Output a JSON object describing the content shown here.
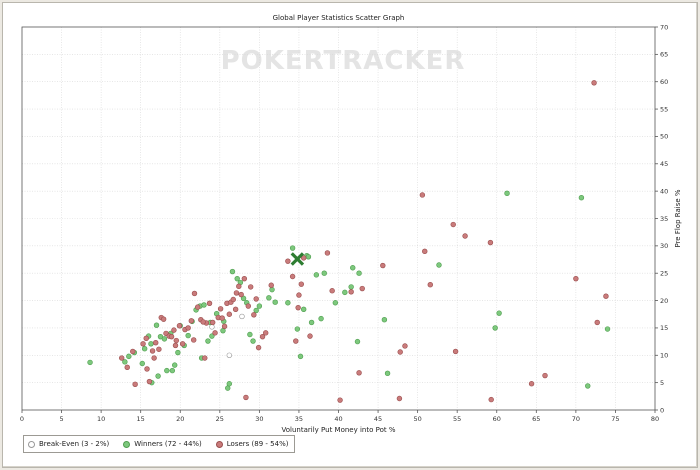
{
  "chart_data": {
    "type": "scatter",
    "title": "Global Player Statistics Scatter Graph",
    "watermark": "POKERTRACKER",
    "xlabel": "Voluntarily Put Money into Pot %",
    "ylabel": "Pre Flop Raise %",
    "xlim": [
      0,
      80
    ],
    "ylim": [
      0,
      70
    ],
    "xticks": [
      0,
      5,
      10,
      15,
      20,
      25,
      30,
      35,
      40,
      45,
      50,
      55,
      60,
      65,
      70,
      75,
      80
    ],
    "yticks": [
      0,
      5,
      10,
      15,
      20,
      25,
      30,
      35,
      40,
      45,
      50,
      55,
      60,
      65,
      70
    ],
    "y_axis_side": "right",
    "grid": true,
    "legend_position": "bottom-left",
    "hero_point": {
      "x": 34.8,
      "y": 27.6,
      "color": "#2e7d32"
    },
    "series": [
      {
        "name": "Break-Even (3 - 2%)",
        "color": "#ffffff",
        "stroke": "#999999",
        "points": [
          [
            26.2,
            10
          ],
          [
            24.0,
            15.2
          ],
          [
            27.8,
            17.1
          ]
        ]
      },
      {
        "name": "Winners (72 - 44%)",
        "color": "#7dc87d",
        "stroke": "#4f9e4f",
        "points": [
          [
            8.6,
            8.7
          ],
          [
            13.0,
            8.8
          ],
          [
            13.5,
            9.8
          ],
          [
            14.2,
            10.5
          ],
          [
            15.2,
            8.5
          ],
          [
            15.5,
            11.2
          ],
          [
            16.0,
            13.5
          ],
          [
            16.3,
            12.1
          ],
          [
            16.4,
            5.0
          ],
          [
            17.0,
            15.5
          ],
          [
            17.2,
            6.2
          ],
          [
            17.5,
            13.4
          ],
          [
            18.0,
            13.0
          ],
          [
            18.3,
            7.2
          ],
          [
            18.8,
            14.0
          ],
          [
            19.0,
            7.2
          ],
          [
            19.3,
            8.2
          ],
          [
            19.7,
            10.5
          ],
          [
            20.0,
            15.4
          ],
          [
            20.5,
            11.8
          ],
          [
            21.0,
            13.6
          ],
          [
            21.5,
            16.2
          ],
          [
            22.0,
            18.3
          ],
          [
            22.5,
            19.0
          ],
          [
            22.7,
            9.5
          ],
          [
            23.0,
            19.2
          ],
          [
            23.5,
            12.6
          ],
          [
            23.8,
            16.0
          ],
          [
            24.0,
            13.5
          ],
          [
            24.6,
            17.6
          ],
          [
            25.4,
            14.5
          ],
          [
            25.5,
            16.2
          ],
          [
            26.0,
            4.0
          ],
          [
            26.2,
            4.8
          ],
          [
            26.6,
            25.3
          ],
          [
            27.2,
            24.0
          ],
          [
            27.6,
            23.3
          ],
          [
            28.0,
            20.4
          ],
          [
            28.4,
            19.6
          ],
          [
            28.8,
            13.8
          ],
          [
            29.2,
            12.6
          ],
          [
            29.6,
            18.2
          ],
          [
            30.0,
            19.0
          ],
          [
            31.2,
            20.5
          ],
          [
            31.6,
            22.0
          ],
          [
            32.0,
            19.7
          ],
          [
            33.6,
            19.6
          ],
          [
            34.2,
            29.6
          ],
          [
            34.8,
            14.8
          ],
          [
            35.2,
            9.8
          ],
          [
            35.6,
            18.4
          ],
          [
            36.0,
            28.2
          ],
          [
            36.6,
            16.0
          ],
          [
            37.2,
            24.7
          ],
          [
            37.8,
            16.7
          ],
          [
            38.2,
            25.0
          ],
          [
            39.6,
            19.6
          ],
          [
            40.8,
            21.5
          ],
          [
            41.6,
            22.5
          ],
          [
            41.8,
            26.0
          ],
          [
            42.4,
            12.5
          ],
          [
            42.6,
            25.0
          ],
          [
            45.8,
            16.5
          ],
          [
            46.2,
            6.7
          ],
          [
            52.7,
            26.5
          ],
          [
            59.8,
            15.0
          ],
          [
            60.3,
            17.7
          ],
          [
            61.3,
            39.6
          ],
          [
            70.7,
            38.8
          ],
          [
            71.5,
            4.4
          ],
          [
            74.0,
            14.8
          ],
          [
            36.2,
            28.0
          ]
        ]
      },
      {
        "name": "Losers (89 - 54%)",
        "color": "#c97b7b",
        "stroke": "#9a4e4e",
        "points": [
          [
            12.6,
            9.5
          ],
          [
            13.3,
            7.8
          ],
          [
            14.0,
            10.7
          ],
          [
            14.3,
            4.7
          ],
          [
            15.3,
            12.1
          ],
          [
            15.7,
            13.1
          ],
          [
            15.8,
            7.5
          ],
          [
            16.1,
            5.2
          ],
          [
            16.5,
            10.8
          ],
          [
            16.9,
            12.3
          ],
          [
            17.3,
            11.1
          ],
          [
            17.6,
            16.9
          ],
          [
            17.9,
            16.6
          ],
          [
            18.2,
            14.0
          ],
          [
            18.6,
            13.5
          ],
          [
            18.9,
            13.4
          ],
          [
            19.2,
            14.6
          ],
          [
            19.5,
            12.7
          ],
          [
            19.9,
            15.4
          ],
          [
            20.3,
            12.1
          ],
          [
            20.6,
            14.7
          ],
          [
            21.0,
            15.0
          ],
          [
            21.4,
            16.3
          ],
          [
            21.7,
            12.8
          ],
          [
            21.8,
            21.3
          ],
          [
            22.2,
            18.8
          ],
          [
            22.6,
            16.5
          ],
          [
            23.1,
            9.5
          ],
          [
            23.3,
            15.9
          ],
          [
            23.7,
            19.5
          ],
          [
            24.1,
            16.0
          ],
          [
            24.4,
            14.1
          ],
          [
            24.8,
            16.9
          ],
          [
            25.1,
            18.5
          ],
          [
            25.3,
            16.8
          ],
          [
            25.6,
            15.3
          ],
          [
            25.9,
            19.5
          ],
          [
            26.2,
            17.5
          ],
          [
            26.4,
            19.7
          ],
          [
            26.7,
            20.2
          ],
          [
            27.1,
            21.4
          ],
          [
            27.4,
            22.6
          ],
          [
            27.7,
            21.1
          ],
          [
            28.1,
            24.0
          ],
          [
            28.3,
            2.3
          ],
          [
            28.6,
            19.0
          ],
          [
            28.9,
            22.5
          ],
          [
            29.3,
            17.4
          ],
          [
            29.6,
            20.3
          ],
          [
            29.9,
            11.4
          ],
          [
            30.4,
            13.4
          ],
          [
            30.8,
            14.1
          ],
          [
            31.5,
            22.8
          ],
          [
            33.6,
            27.2
          ],
          [
            34.2,
            24.4
          ],
          [
            34.6,
            12.6
          ],
          [
            35.0,
            21.0
          ],
          [
            35.3,
            23.0
          ],
          [
            35.6,
            27.8
          ],
          [
            36.4,
            13.5
          ],
          [
            38.6,
            28.7
          ],
          [
            39.2,
            21.8
          ],
          [
            40.2,
            1.8
          ],
          [
            41.6,
            21.6
          ],
          [
            42.6,
            6.8
          ],
          [
            43.0,
            22.2
          ],
          [
            45.6,
            26.4
          ],
          [
            47.7,
            2.1
          ],
          [
            47.8,
            10.6
          ],
          [
            48.4,
            11.7
          ],
          [
            50.6,
            39.3
          ],
          [
            50.9,
            29.0
          ],
          [
            51.6,
            22.9
          ],
          [
            54.5,
            33.9
          ],
          [
            54.8,
            10.7
          ],
          [
            56.0,
            31.8
          ],
          [
            59.2,
            30.6
          ],
          [
            59.3,
            1.9
          ],
          [
            64.4,
            4.8
          ],
          [
            66.1,
            6.3
          ],
          [
            70.0,
            24.0
          ],
          [
            72.3,
            59.8
          ],
          [
            72.7,
            16.0
          ],
          [
            73.8,
            20.8
          ],
          [
            34.9,
            18.7
          ],
          [
            27.0,
            18.4
          ],
          [
            22.9,
            16.1
          ],
          [
            19.4,
            11.8
          ],
          [
            16.7,
            9.5
          ]
        ]
      }
    ]
  }
}
